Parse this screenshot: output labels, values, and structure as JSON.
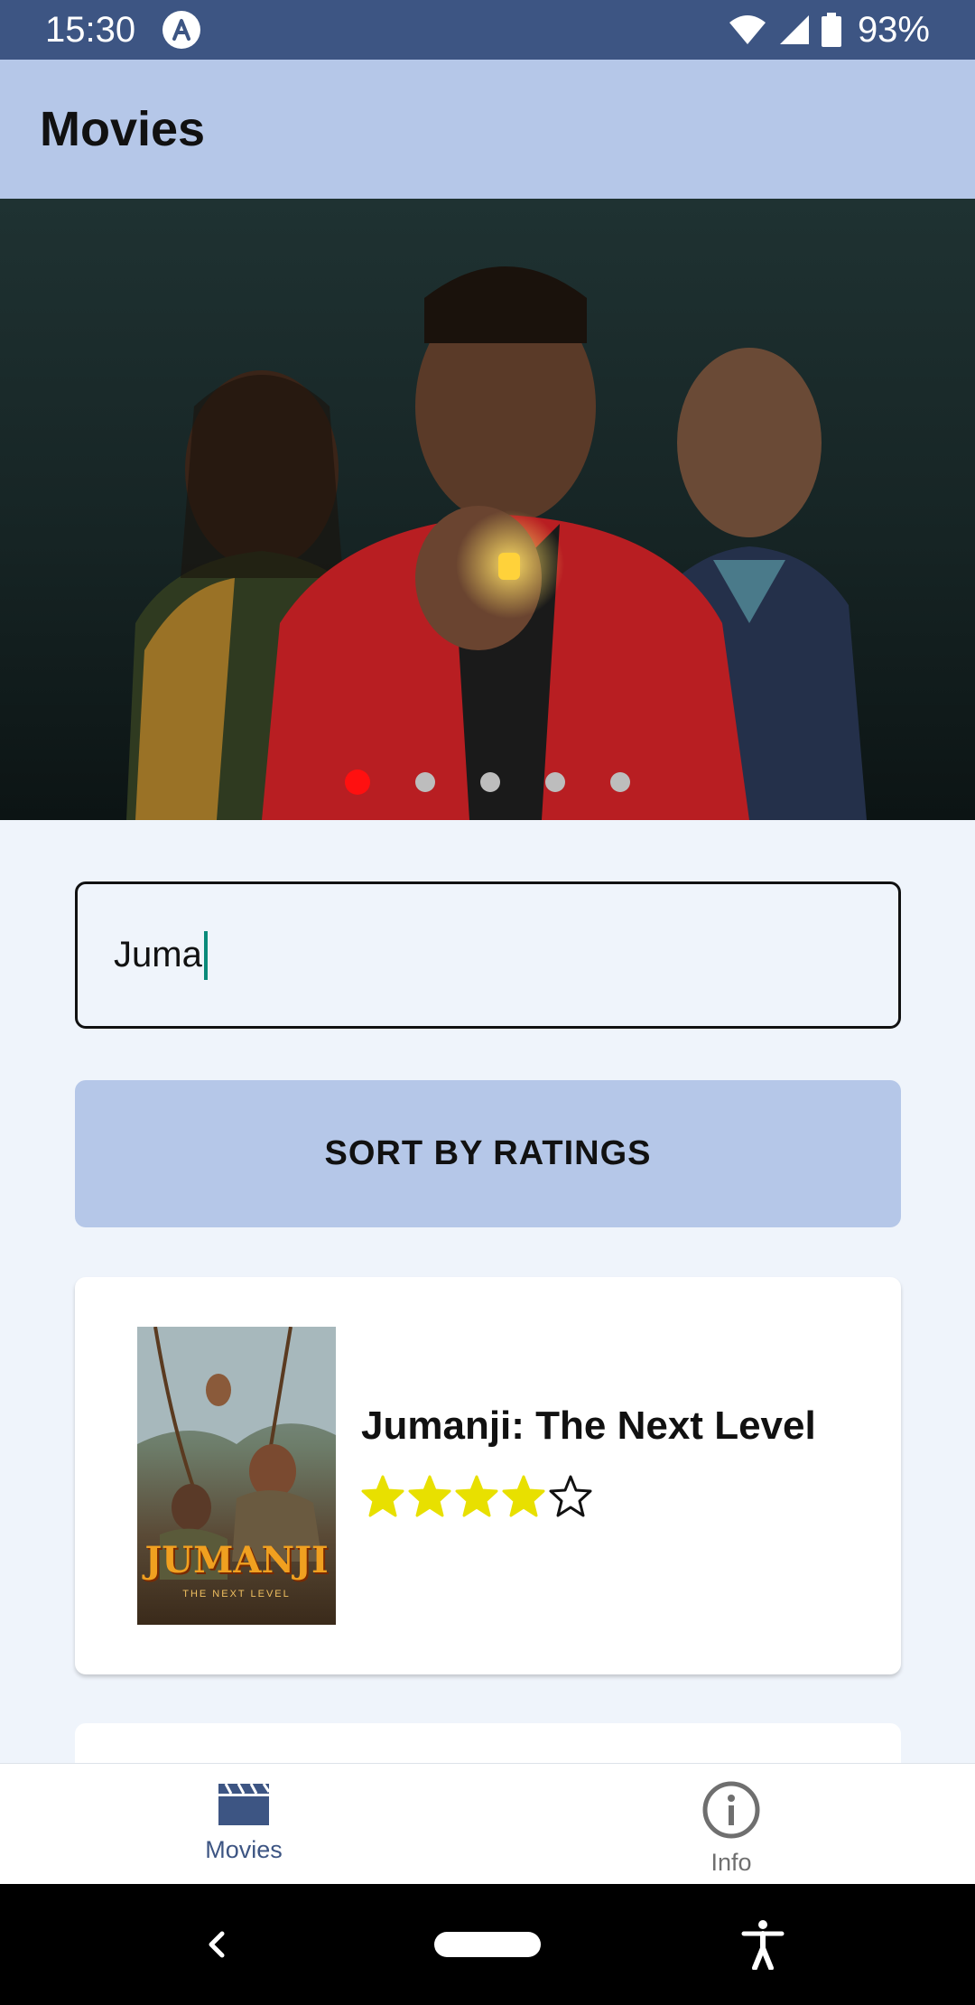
{
  "status_bar": {
    "time": "15:30",
    "battery": "93%",
    "icons": [
      "app-notification-icon",
      "wifi-icon",
      "cell-signal-icon",
      "battery-icon"
    ]
  },
  "app_bar": {
    "title": "Movies"
  },
  "carousel": {
    "slide_count": 5,
    "active_index": 0,
    "active_dot_color": "#ff1010",
    "inactive_dot_color": "#bdbdbd"
  },
  "search": {
    "value": "Juma"
  },
  "sort_button": {
    "label": "SORT BY RATINGS"
  },
  "movies": [
    {
      "title": "Jumanji: The Next Level",
      "rating": 4,
      "max_rating": 5,
      "poster_text": "JUMANJI",
      "poster_subtext": "THE NEXT LEVEL"
    }
  ],
  "bottom_nav": {
    "items": [
      {
        "label": "Movies",
        "icon": "clapperboard-icon",
        "active": true
      },
      {
        "label": "Info",
        "icon": "info-icon",
        "active": false
      }
    ]
  },
  "colors": {
    "status_bar": "#3d5583",
    "app_bar": "#b5c7e8",
    "background": "#eff4fb",
    "star_filled": "#e8e000",
    "accent": "#3d5583"
  }
}
